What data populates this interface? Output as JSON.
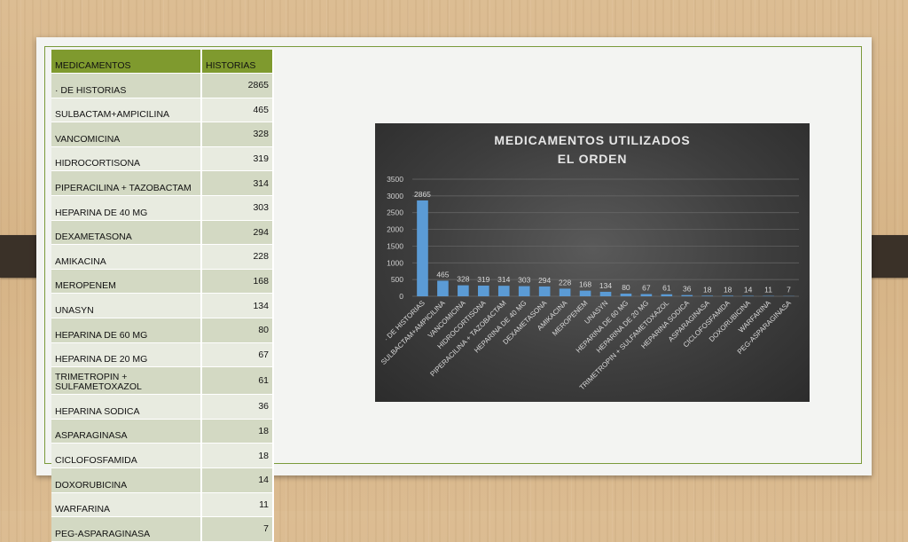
{
  "table": {
    "headers": [
      "MEDICAMENTOS",
      "HISTORIAS"
    ],
    "rows": [
      {
        "name": "· DE HISTORIAS",
        "value": "2865"
      },
      {
        "name": "SULBACTAM+AMPICILINA",
        "value": "465"
      },
      {
        "name": "VANCOMICINA",
        "value": "328"
      },
      {
        "name": "HIDROCORTISONA",
        "value": "319"
      },
      {
        "name": "PIPERACILINA + TAZOBACTAM",
        "value": "314"
      },
      {
        "name": "HEPARINA DE 40 MG",
        "value": "303"
      },
      {
        "name": "DEXAMETASONA",
        "value": "294"
      },
      {
        "name": "AMIKACINA",
        "value": "228"
      },
      {
        "name": "MEROPENEM",
        "value": "168"
      },
      {
        "name": "UNASYN",
        "value": "134"
      },
      {
        "name": "HEPARINA DE 60 MG",
        "value": "80"
      },
      {
        "name": "HEPARINA DE 20 MG",
        "value": "67"
      },
      {
        "name": "TRIMETROPIN + SULFAMETOXAZOL",
        "value": "61"
      },
      {
        "name": "HEPARINA SODICA",
        "value": "36"
      },
      {
        "name": "ASPARAGINASA",
        "value": "18"
      },
      {
        "name": "CICLOFOSFAMIDA",
        "value": "18"
      },
      {
        "name": "DOXORUBICINA",
        "value": "14"
      },
      {
        "name": "WARFARINA",
        "value": "11"
      },
      {
        "name": "PEG-ASPARAGINASA",
        "value": "7"
      }
    ]
  },
  "chart_data": {
    "type": "bar",
    "title": [
      "MEDICAMENTOS UTILIZADOS",
      "EL ORDEN"
    ],
    "categories": [
      "· DE HISTORIAS",
      "SULBACTAM+AMPICILINA",
      "VANCOMICINA",
      "HIDROCORTISONA",
      "PIPERACILINA + TAZOBACTAM",
      "HEPARINA DE 40 MG",
      "DEXAMETASONA",
      "AMIKACINA",
      "MEROPENEM",
      "UNASYN",
      "HEPARINA DE 60 MG",
      "HEPARINA DE 20 MG",
      "TRIMETROPIN + SULFAMETOXAZOL",
      "HEPARINA SODICA",
      "ASPARAGINASA",
      "CICLOFOSFAMIDA",
      "DOXORUBICINA",
      "WARFARINA",
      "PEG-ASPARAGINASA"
    ],
    "values": [
      2865,
      465,
      328,
      319,
      314,
      303,
      294,
      228,
      168,
      134,
      80,
      67,
      61,
      36,
      18,
      18,
      14,
      11,
      7
    ],
    "ylim": [
      0,
      3500
    ],
    "yticks": [
      0,
      500,
      1000,
      1500,
      2000,
      2500,
      3000,
      3500
    ],
    "grid": true,
    "data_labels": true,
    "bar_color": "#5b9bd5",
    "background": "#404040"
  }
}
